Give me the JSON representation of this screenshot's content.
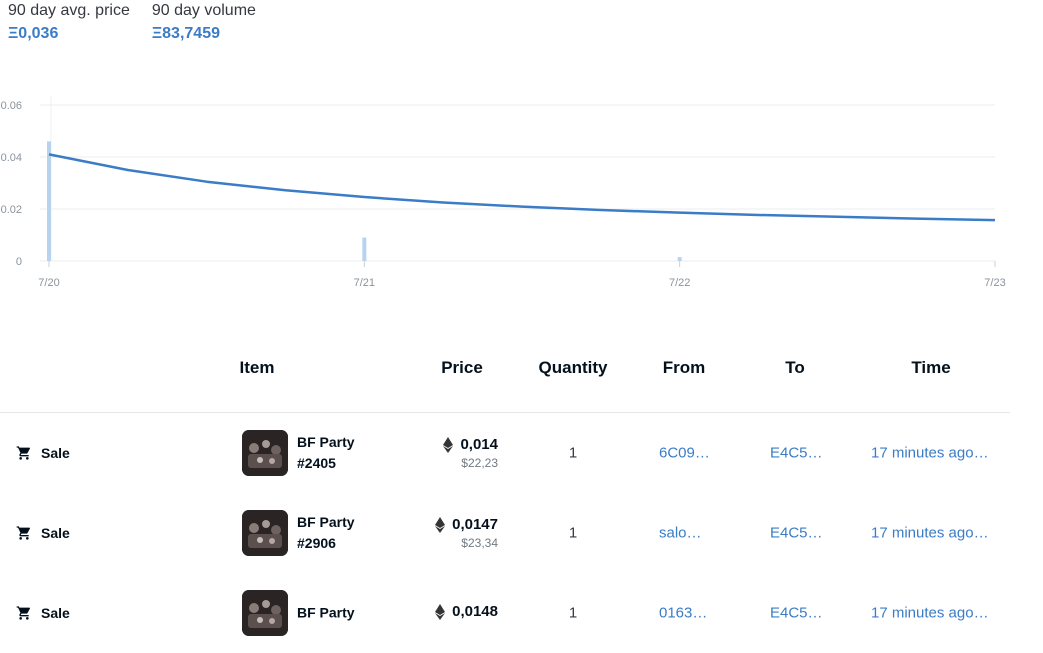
{
  "stats": {
    "avg_label": "90 day avg. price",
    "avg_value": "Ξ0,036",
    "volume_label": "90 day volume",
    "volume_value": "Ξ83,7459"
  },
  "chart_data": {
    "type": "line",
    "x_ticks": [
      "7/20",
      "7/21",
      "7/22",
      "7/23"
    ],
    "y_ticks": [
      "0.06",
      "0.04",
      "0.02",
      "0"
    ],
    "ylim": [
      0,
      0.06
    ],
    "series": [
      {
        "x": [
          0,
          0.25,
          0.5,
          0.75,
          1,
          1.25,
          1.5,
          1.75,
          2,
          2.25,
          2.5,
          2.75,
          3
        ],
        "values": [
          0.041,
          0.035,
          0.0305,
          0.0272,
          0.0246,
          0.0225,
          0.0209,
          0.0196,
          0.0186,
          0.0177,
          0.017,
          0.0163,
          0.0157
        ]
      }
    ],
    "volume_bars": [
      {
        "x": 0.0,
        "value": 0.046
      },
      {
        "x": 1.0,
        "value": 0.009
      },
      {
        "x": 2.0,
        "value": 0.0015
      }
    ],
    "colors": {
      "line": "#3a7cc6",
      "bars": "#b8d3ee",
      "grid": "#e8ecf0"
    }
  },
  "table": {
    "headers": {
      "item": "Item",
      "price": "Price",
      "quantity": "Quantity",
      "from": "From",
      "to": "To",
      "time": "Time"
    },
    "rows": [
      {
        "event": "Sale",
        "item_line1": "BF Party",
        "item_line2": "#2405",
        "price_eth": "0,014",
        "price_usd": "$22,23",
        "quantity": "1",
        "from": "6C09…",
        "to": "E4C5…",
        "time": "17 minutes ago…"
      },
      {
        "event": "Sale",
        "item_line1": "BF Party",
        "item_line2": "#2906",
        "price_eth": "0,0147",
        "price_usd": "$23,34",
        "quantity": "1",
        "from": "salo…",
        "to": "E4C5…",
        "time": "17 minutes ago…"
      },
      {
        "event": "Sale",
        "item_line1": "BF Party",
        "item_line2": "",
        "price_eth": "0,0148",
        "price_usd": "",
        "quantity": "1",
        "from": "0163…",
        "to": "E4C5…",
        "time": "17 minutes ago…"
      }
    ]
  }
}
